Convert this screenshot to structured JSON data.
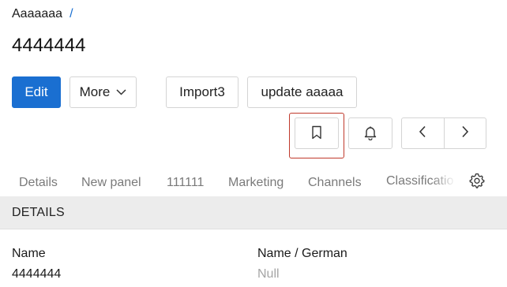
{
  "breadcrumb": {
    "item": "Aaaaaaa",
    "separator": "/"
  },
  "page_title": "4444444",
  "toolbar": {
    "edit_label": "Edit",
    "more_label": "More",
    "import_label": "Import3",
    "update_label": "update aaaaa",
    "accent_color": "#1a6fd1"
  },
  "icons": {
    "bookmark": "bookmark-icon",
    "bell": "bell-icon",
    "prev": "chevron-left-icon",
    "next": "chevron-right-icon",
    "settings": "gear-icon"
  },
  "tabs": [
    {
      "label": "Details"
    },
    {
      "label": "New panel"
    },
    {
      "label": "111111"
    },
    {
      "label": "Marketing"
    },
    {
      "label": "Channels"
    },
    {
      "label": "Classificatio"
    }
  ],
  "section": {
    "title": "DETAILS"
  },
  "fields": [
    {
      "label": "Name",
      "value": "4444444"
    },
    {
      "label": "Name / German",
      "value": "Null"
    }
  ]
}
